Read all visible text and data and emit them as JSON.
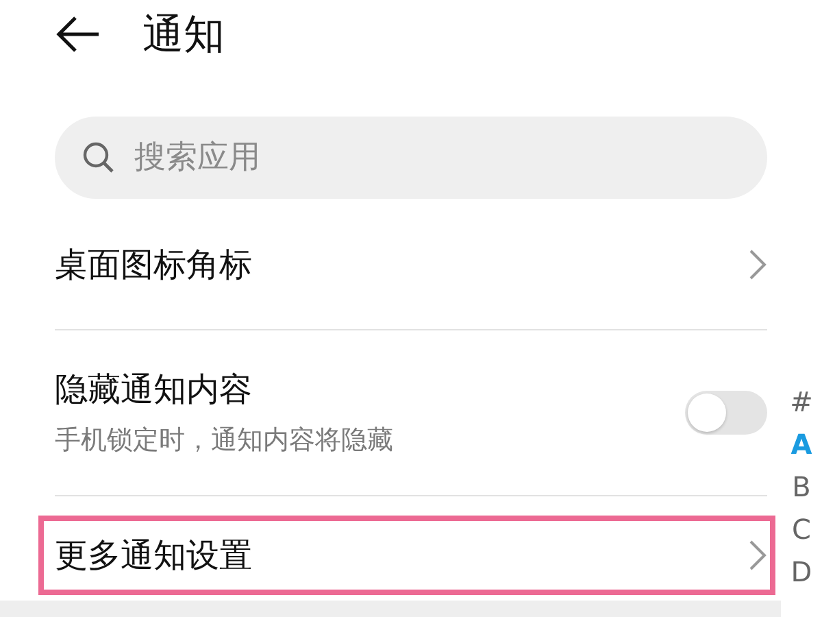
{
  "header": {
    "title": "通知"
  },
  "search": {
    "placeholder": "搜索应用"
  },
  "rows": [
    {
      "kind": "link",
      "title": "桌面图标角标",
      "highlighted": false
    },
    {
      "kind": "toggle",
      "title": "隐藏通知内容",
      "subtitle": "手机锁定时，通知内容将隐藏",
      "on": false
    },
    {
      "kind": "link",
      "title": "更多通知设置",
      "highlighted": true
    }
  ],
  "index": [
    {
      "label": "#",
      "selected": false
    },
    {
      "label": "A",
      "selected": true
    },
    {
      "label": "B",
      "selected": false
    },
    {
      "label": "C",
      "selected": false
    },
    {
      "label": "D",
      "selected": false
    }
  ]
}
